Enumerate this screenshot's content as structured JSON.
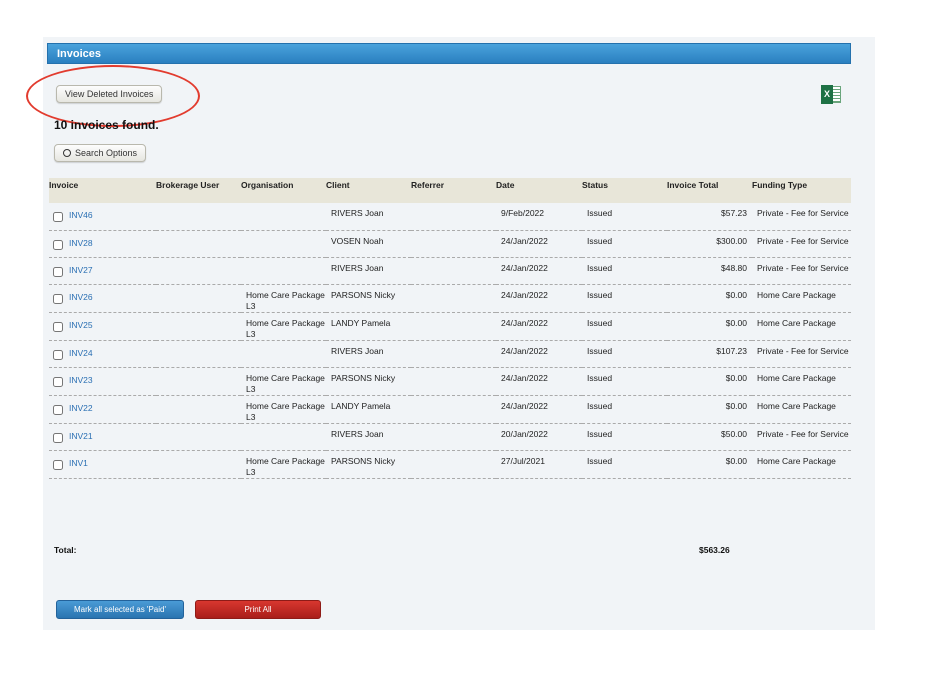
{
  "title": "Invoices",
  "view_deleted_label": "View Deleted Invoices",
  "found_text": "10 invoices found.",
  "search_options_label": "Search Options",
  "export_icon": "excel-icon",
  "columns": [
    "Invoice",
    "Brokerage User",
    "Organisation",
    "Client",
    "Referrer",
    "Date",
    "Status",
    "Invoice Total",
    "Funding Type"
  ],
  "rows": [
    {
      "invoice": "INV46",
      "brokerage": "",
      "org": "",
      "client": "RIVERS Joan",
      "referrer": "",
      "date": "9/Feb/2022",
      "status": "Issued",
      "total": "$57.23",
      "funding": "Private - Fee for Service"
    },
    {
      "invoice": "INV28",
      "brokerage": "",
      "org": "",
      "client": "VOSEN Noah",
      "referrer": "",
      "date": "24/Jan/2022",
      "status": "Issued",
      "total": "$300.00",
      "funding": "Private - Fee for Service"
    },
    {
      "invoice": "INV27",
      "brokerage": "",
      "org": "",
      "client": "RIVERS Joan",
      "referrer": "",
      "date": "24/Jan/2022",
      "status": "Issued",
      "total": "$48.80",
      "funding": "Private - Fee for Service"
    },
    {
      "invoice": "INV26",
      "brokerage": "",
      "org": "Home Care Package L3",
      "client": "PARSONS Nicky",
      "referrer": "",
      "date": "24/Jan/2022",
      "status": "Issued",
      "total": "$0.00",
      "funding": "Home Care Package"
    },
    {
      "invoice": "INV25",
      "brokerage": "",
      "org": "Home Care Package L3",
      "client": "LANDY Pamela",
      "referrer": "",
      "date": "24/Jan/2022",
      "status": "Issued",
      "total": "$0.00",
      "funding": "Home Care Package"
    },
    {
      "invoice": "INV24",
      "brokerage": "",
      "org": "",
      "client": "RIVERS Joan",
      "referrer": "",
      "date": "24/Jan/2022",
      "status": "Issued",
      "total": "$107.23",
      "funding": "Private - Fee for Service"
    },
    {
      "invoice": "INV23",
      "brokerage": "",
      "org": "Home Care Package L3",
      "client": "PARSONS Nicky",
      "referrer": "",
      "date": "24/Jan/2022",
      "status": "Issued",
      "total": "$0.00",
      "funding": "Home Care Package"
    },
    {
      "invoice": "INV22",
      "brokerage": "",
      "org": "Home Care Package L3",
      "client": "LANDY Pamela",
      "referrer": "",
      "date": "24/Jan/2022",
      "status": "Issued",
      "total": "$0.00",
      "funding": "Home Care Package"
    },
    {
      "invoice": "INV21",
      "brokerage": "",
      "org": "",
      "client": "RIVERS Joan",
      "referrer": "",
      "date": "20/Jan/2022",
      "status": "Issued",
      "total": "$50.00",
      "funding": "Private - Fee for Service"
    },
    {
      "invoice": "INV1",
      "brokerage": "",
      "org": "Home Care Package L3",
      "client": "PARSONS Nicky",
      "referrer": "",
      "date": "27/Jul/2021",
      "status": "Issued",
      "total": "$0.00",
      "funding": "Home Care Package"
    }
  ],
  "total_label": "Total:",
  "total_value": "$563.26",
  "mark_paid_label": "Mark all selected as 'Paid'",
  "print_all_label": "Print All",
  "colors": {
    "title_bar": "#2a7fc0",
    "mark_paid": "#2f84c4",
    "print_all": "#c52a24",
    "annotation": "#e23b2e"
  }
}
